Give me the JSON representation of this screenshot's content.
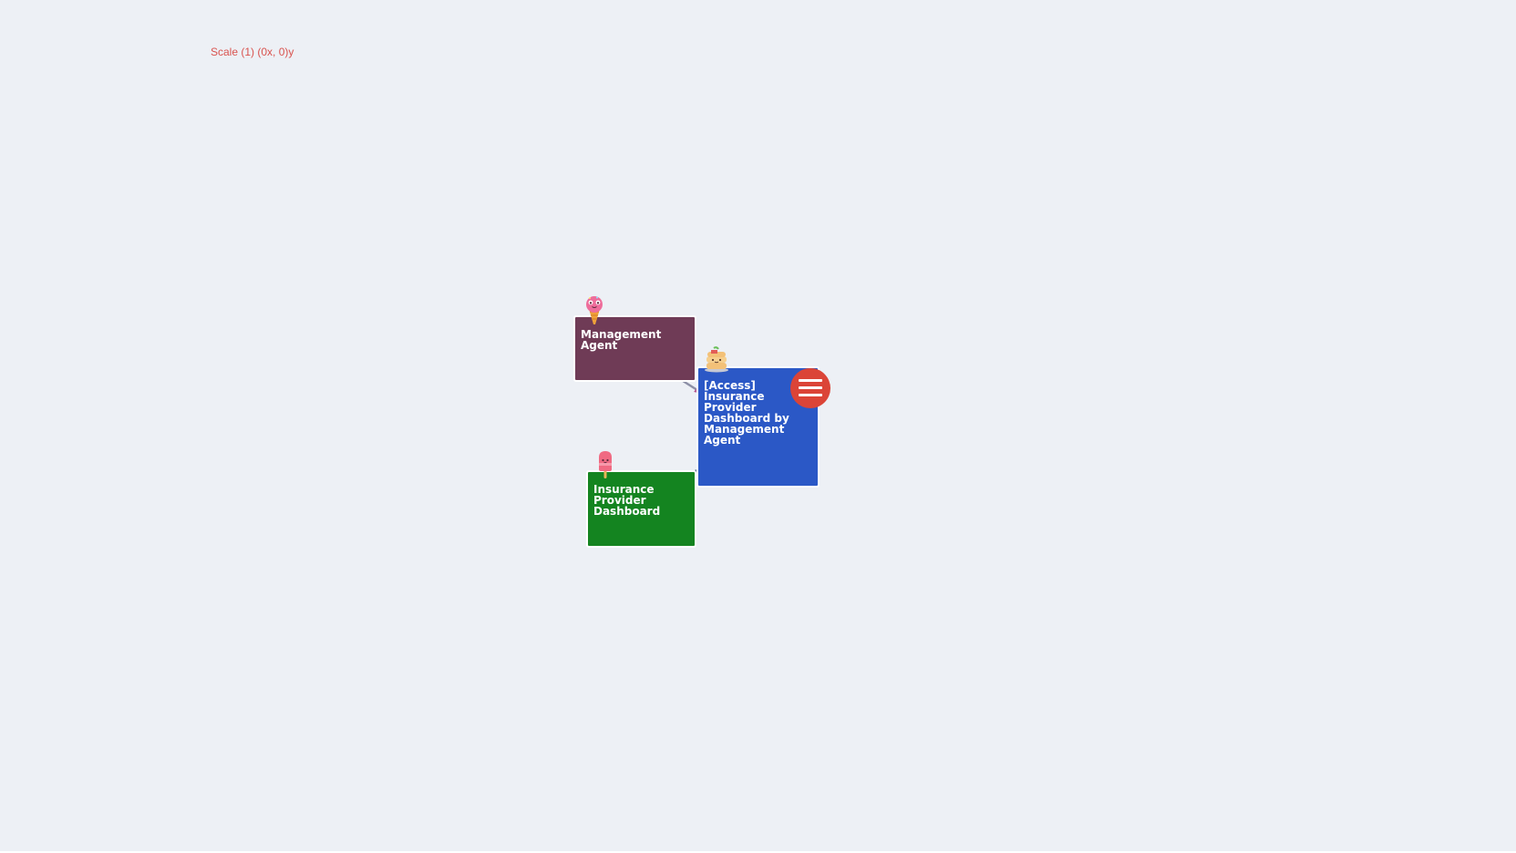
{
  "header": {
    "scale_label": "Scale (1) (0x, 0)y"
  },
  "toolbar": {
    "menu_icon": "hamburger-menu-icon",
    "menu_color": "#db4437"
  },
  "nodes": [
    {
      "id": "management-agent",
      "label": "Management\nAgent",
      "color": "#6f3b56",
      "mascot": "ice-cream-cone-mascot"
    },
    {
      "id": "access-dashboard",
      "label": "[Access]\nInsurance\nProvider\nDashboard by\nManagement\nAgent",
      "color": "#2b58c6",
      "mascot": "pancake-stack-mascot"
    },
    {
      "id": "insurance-provider-dashboard",
      "label": "Insurance\nProvider\nDashboard",
      "color": "#148420",
      "mascot": "popsicle-mascot"
    }
  ],
  "edges": [
    {
      "from": "management-agent",
      "to": "access-dashboard"
    },
    {
      "from": "access-dashboard",
      "to": "insurance-provider-dashboard"
    }
  ],
  "theme": {
    "background": "#edf0f5",
    "scale_label_color": "#d9534f"
  }
}
